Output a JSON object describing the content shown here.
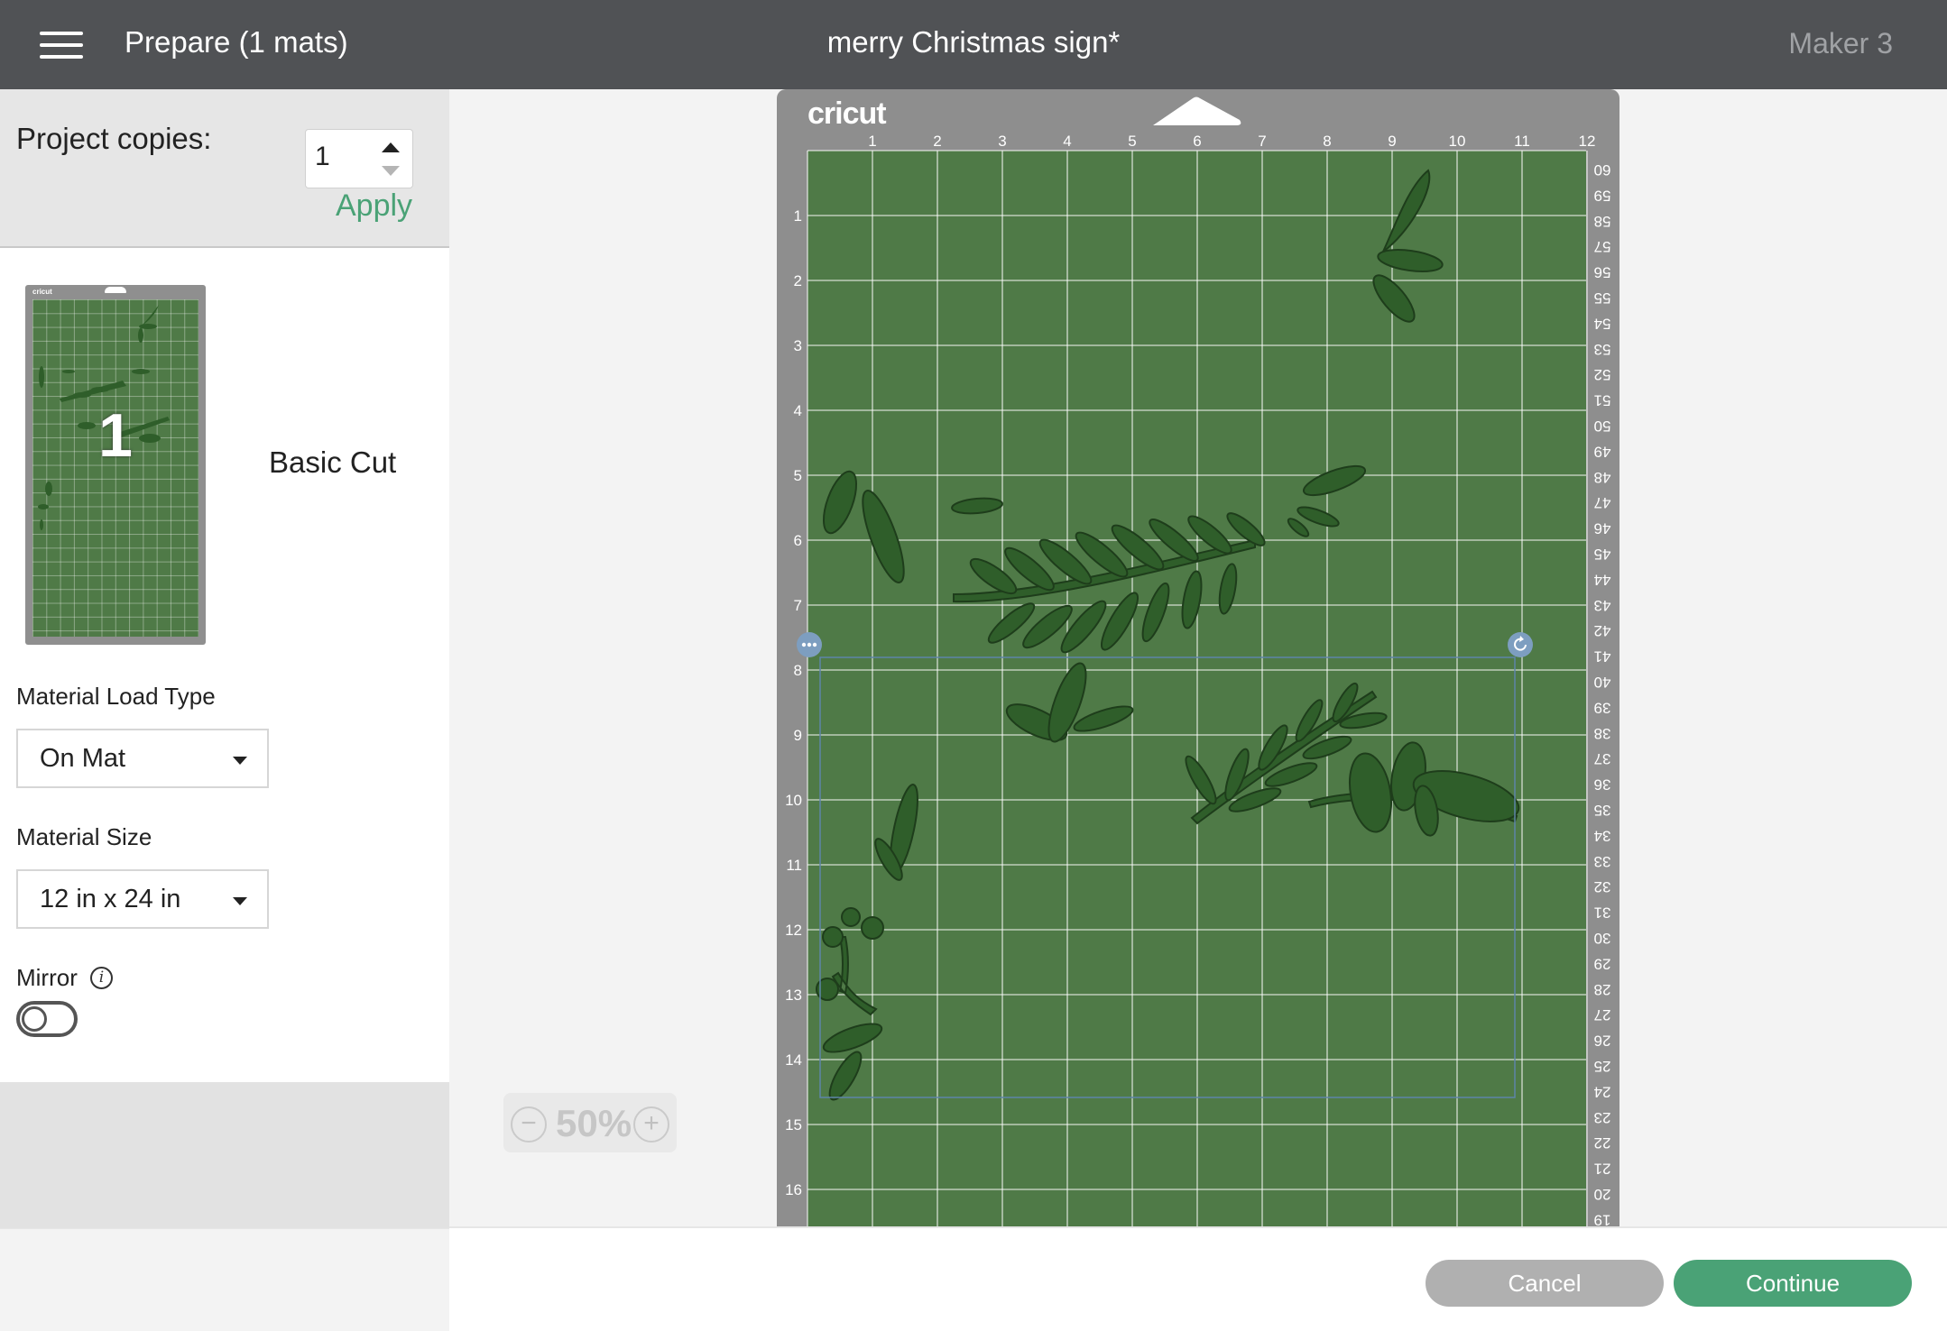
{
  "header": {
    "menu_icon": "hamburger-menu-icon",
    "prepare_title": "Prepare (1 mats)",
    "project_title": "merry Christmas sign*",
    "machine": "Maker 3"
  },
  "sidebar": {
    "copies_label": "Project copies:",
    "copies_value": "1",
    "apply_label": "Apply",
    "mat_thumbnail": {
      "number": "1",
      "logo": "cricut",
      "label": "Basic Cut"
    },
    "material_load_type": {
      "label": "Material Load Type",
      "value": "On Mat"
    },
    "material_size": {
      "label": "Material Size",
      "value": "12 in x 24 in"
    },
    "mirror": {
      "label": "Mirror",
      "info_icon": "info-icon",
      "enabled": false
    }
  },
  "canvas": {
    "zoom": {
      "value": "50%",
      "minus": "−",
      "plus": "+"
    },
    "mat": {
      "logo": "cricut",
      "top_ruler": [
        "1",
        "2",
        "3",
        "4",
        "5",
        "6",
        "7",
        "8",
        "9",
        "10",
        "11",
        "12"
      ],
      "left_ruler": [
        "1",
        "2",
        "3",
        "4",
        "5",
        "6",
        "7",
        "8",
        "9",
        "10",
        "11",
        "12",
        "13",
        "14",
        "15",
        "16"
      ],
      "right_ruler": [
        "60",
        "59",
        "58",
        "57",
        "56",
        "55",
        "54",
        "53",
        "52",
        "51",
        "50",
        "49",
        "48",
        "47",
        "46",
        "45",
        "44",
        "43",
        "42",
        "41",
        "40",
        "39",
        "38",
        "37",
        "36",
        "35",
        "34",
        "33",
        "32",
        "31",
        "30",
        "29",
        "28",
        "27",
        "26",
        "25",
        "24",
        "23",
        "22",
        "21",
        "20",
        "19"
      ],
      "color": "#4f7a47",
      "leaf_color": "#2f5e2a"
    }
  },
  "footer": {
    "cancel_label": "Cancel",
    "continue_label": "Continue"
  },
  "colors": {
    "accent": "#4aa276",
    "header_bg": "#505255"
  }
}
